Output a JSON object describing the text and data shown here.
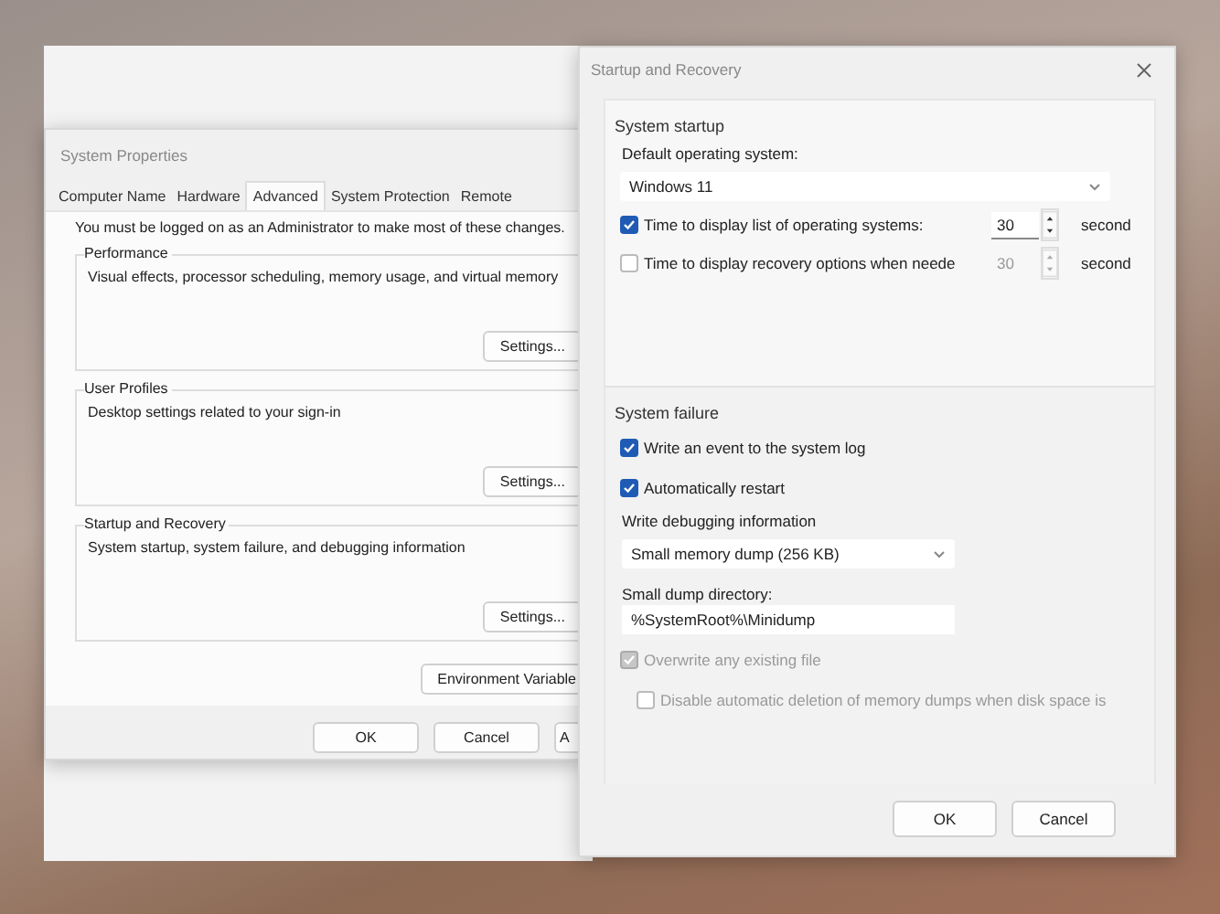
{
  "system_properties": {
    "title": "System Properties",
    "tabs": [
      {
        "label": "Computer Name",
        "selected": false
      },
      {
        "label": "Hardware",
        "selected": false
      },
      {
        "label": "Advanced",
        "selected": true
      },
      {
        "label": "System Protection",
        "selected": false
      },
      {
        "label": "Remote",
        "selected": false
      }
    ],
    "admin_note": "You must be logged on as an Administrator to make most of these changes.",
    "groups": [
      {
        "title": "Performance",
        "description": "Visual effects, processor scheduling, memory usage, and virtual memory",
        "button": "Settings..."
      },
      {
        "title": "User Profiles",
        "description": "Desktop settings related to your sign-in",
        "button": "Settings..."
      },
      {
        "title": "Startup and Recovery",
        "description": "System startup, system failure, and debugging information",
        "button": "Settings..."
      }
    ],
    "environment_button": "Environment Variable",
    "buttons": [
      "OK",
      "Cancel",
      "A"
    ]
  },
  "startup_recovery": {
    "title": "Startup and Recovery",
    "system_startup": {
      "heading": "System startup",
      "default_os_label": "Default operating system:",
      "default_os": "Windows 11",
      "timers": [
        {
          "label": "Time to display list of operating systems:",
          "checked": true,
          "disabled": false,
          "value": "30",
          "unit": "second"
        },
        {
          "label": "Time to display recovery options when neede",
          "checked": false,
          "disabled": true,
          "value": "30",
          "unit": "second"
        }
      ]
    },
    "system_failure": {
      "heading": "System failure",
      "options": [
        {
          "label": "Write an event to the system log",
          "checked": true,
          "disabled": false
        },
        {
          "label": "Automatically restart",
          "checked": true,
          "disabled": false
        }
      ],
      "debug_label": "Write debugging information",
      "dump_type": "Small memory dump (256 KB)",
      "directory_label": "Small dump directory:",
      "directory": "%SystemRoot%\\Minidump",
      "dump_options": [
        {
          "label": "Overwrite any existing file",
          "checked": true,
          "disabled": true
        },
        {
          "label": "Disable automatic deletion of memory dumps when disk space is",
          "checked": false,
          "disabled": true
        }
      ]
    },
    "buttons": [
      "OK",
      "Cancel"
    ]
  }
}
